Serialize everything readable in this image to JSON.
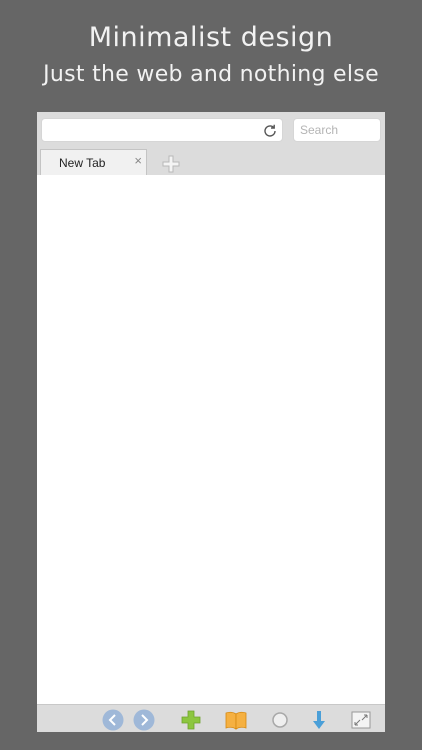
{
  "promo": {
    "headline": "Minimalist design",
    "subheadline": "Just the web and nothing else"
  },
  "addressbar": {
    "url_value": "",
    "search_placeholder": "Search"
  },
  "tabs": [
    {
      "label": "New Tab",
      "close_glyph": "×"
    }
  ],
  "toolbar": {
    "icons": [
      "back-icon",
      "forward-icon",
      "add-bookmark-icon",
      "bookmarks-book-icon",
      "circle-icon",
      "download-icon",
      "fullscreen-icon"
    ]
  },
  "colors": {
    "background": "#666666",
    "accent_green": "#8cc63f",
    "accent_orange": "#f5a623",
    "accent_blue": "#4a9fd8",
    "nav_button": "#9fb8d8"
  }
}
